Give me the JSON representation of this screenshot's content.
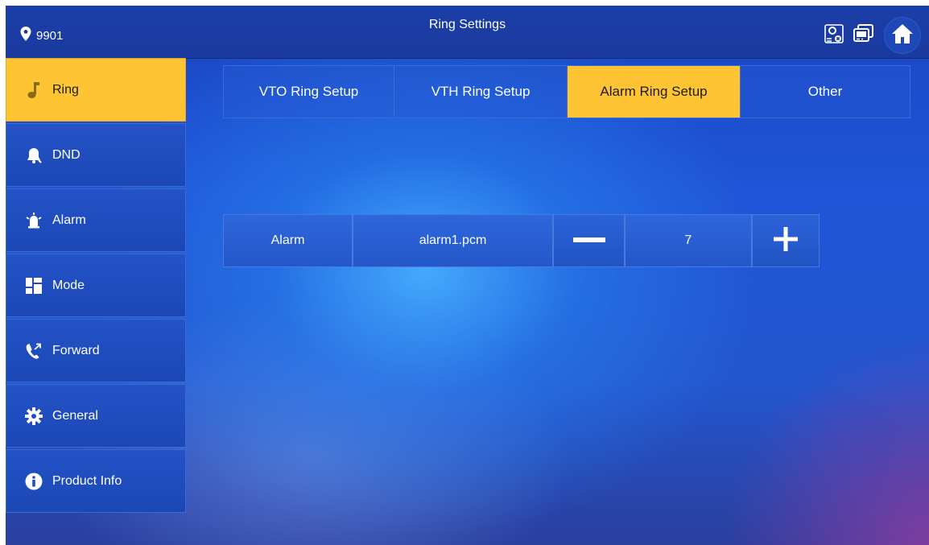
{
  "header": {
    "location": "9901",
    "title": "Ring Settings",
    "icons": [
      "contact-offline-icon",
      "device-icon",
      "home-icon"
    ]
  },
  "sidebar": {
    "items": [
      {
        "label": "Ring",
        "icon": "music-note-icon",
        "active": true
      },
      {
        "label": "DND",
        "icon": "bell-icon"
      },
      {
        "label": "Alarm",
        "icon": "alarm-siren-icon"
      },
      {
        "label": "Mode",
        "icon": "mode-grid-icon"
      },
      {
        "label": "Forward",
        "icon": "call-forward-icon"
      },
      {
        "label": "General",
        "icon": "gear-icon"
      },
      {
        "label": "Product Info",
        "icon": "info-icon"
      }
    ]
  },
  "tabs": [
    {
      "label": "VTO Ring Setup"
    },
    {
      "label": "VTH Ring Setup"
    },
    {
      "label": "Alarm Ring Setup",
      "active": true
    },
    {
      "label": "Other"
    }
  ],
  "alarm_setting": {
    "label": "Alarm",
    "ringtone": "alarm1.pcm",
    "volume": "7",
    "decrease_icon": "minus-icon",
    "increase_icon": "plus-icon"
  },
  "colors": {
    "accent": "#ffc433",
    "panel_blue": "#1f50c8"
  }
}
